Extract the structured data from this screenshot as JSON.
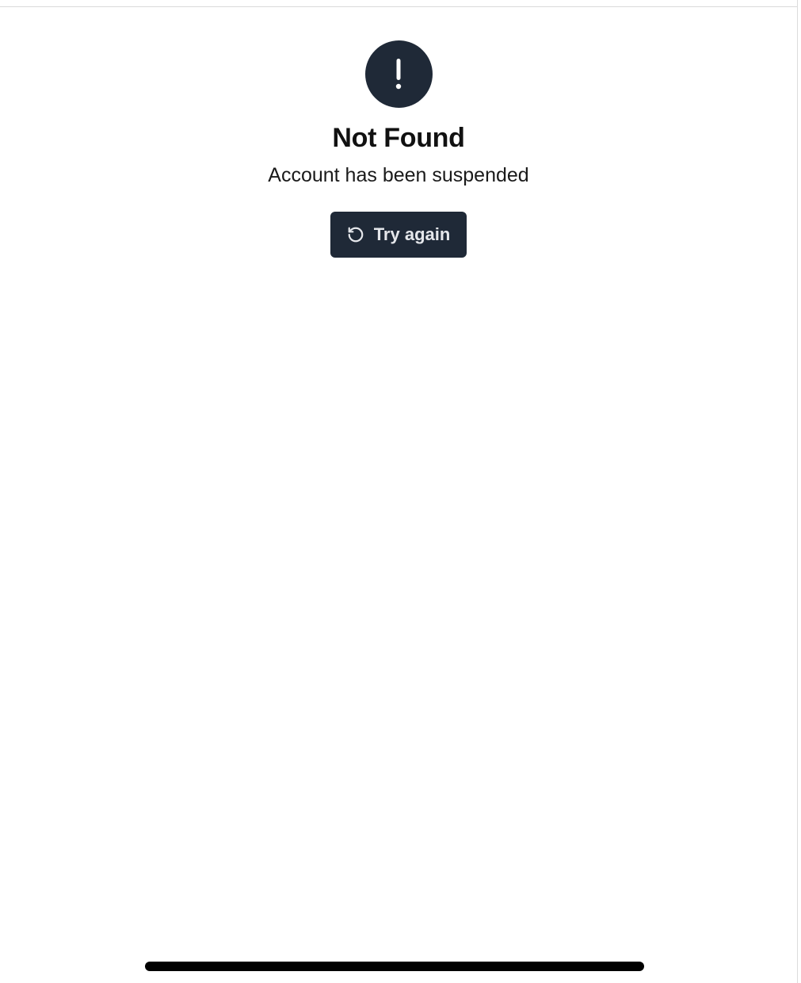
{
  "error": {
    "icon": "alert-exclamation-icon",
    "title": "Not Found",
    "message": "Account has been suspended"
  },
  "retry_button": {
    "icon": "refresh-icon",
    "label": "Try again"
  },
  "colors": {
    "dark": "#1f2937",
    "button_text": "#e5e7eb",
    "background": "#ffffff"
  }
}
